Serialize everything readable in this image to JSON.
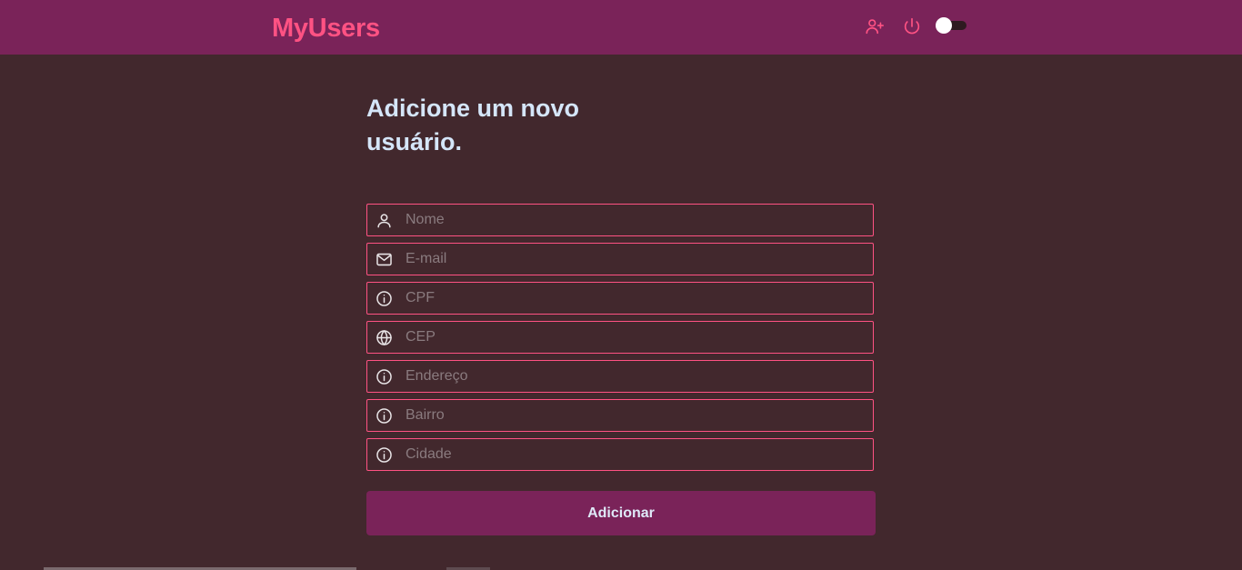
{
  "header": {
    "brand": "MyUsers",
    "icons": {
      "add_user": "user-plus-icon",
      "logout": "power-icon"
    },
    "theme_toggle_on": false
  },
  "form": {
    "title": "Adicione um novo usuário.",
    "fields": [
      {
        "placeholder": "Nome",
        "value": "",
        "icon": "user-icon"
      },
      {
        "placeholder": "E-mail",
        "value": "",
        "icon": "mail-icon"
      },
      {
        "placeholder": "CPF",
        "value": "",
        "icon": "info-icon"
      },
      {
        "placeholder": "CEP",
        "value": "",
        "icon": "globe-icon"
      },
      {
        "placeholder": "Endereço",
        "value": "",
        "icon": "info-icon"
      },
      {
        "placeholder": "Bairro",
        "value": "",
        "icon": "info-icon"
      },
      {
        "placeholder": "Cidade",
        "value": "",
        "icon": "info-icon"
      }
    ],
    "submit_label": "Adicionar"
  },
  "colors": {
    "background": "#42282d",
    "header": "#7a2359",
    "accent": "#ff5283",
    "heading_text": "#d5e6f9",
    "button": "#7a2359"
  }
}
